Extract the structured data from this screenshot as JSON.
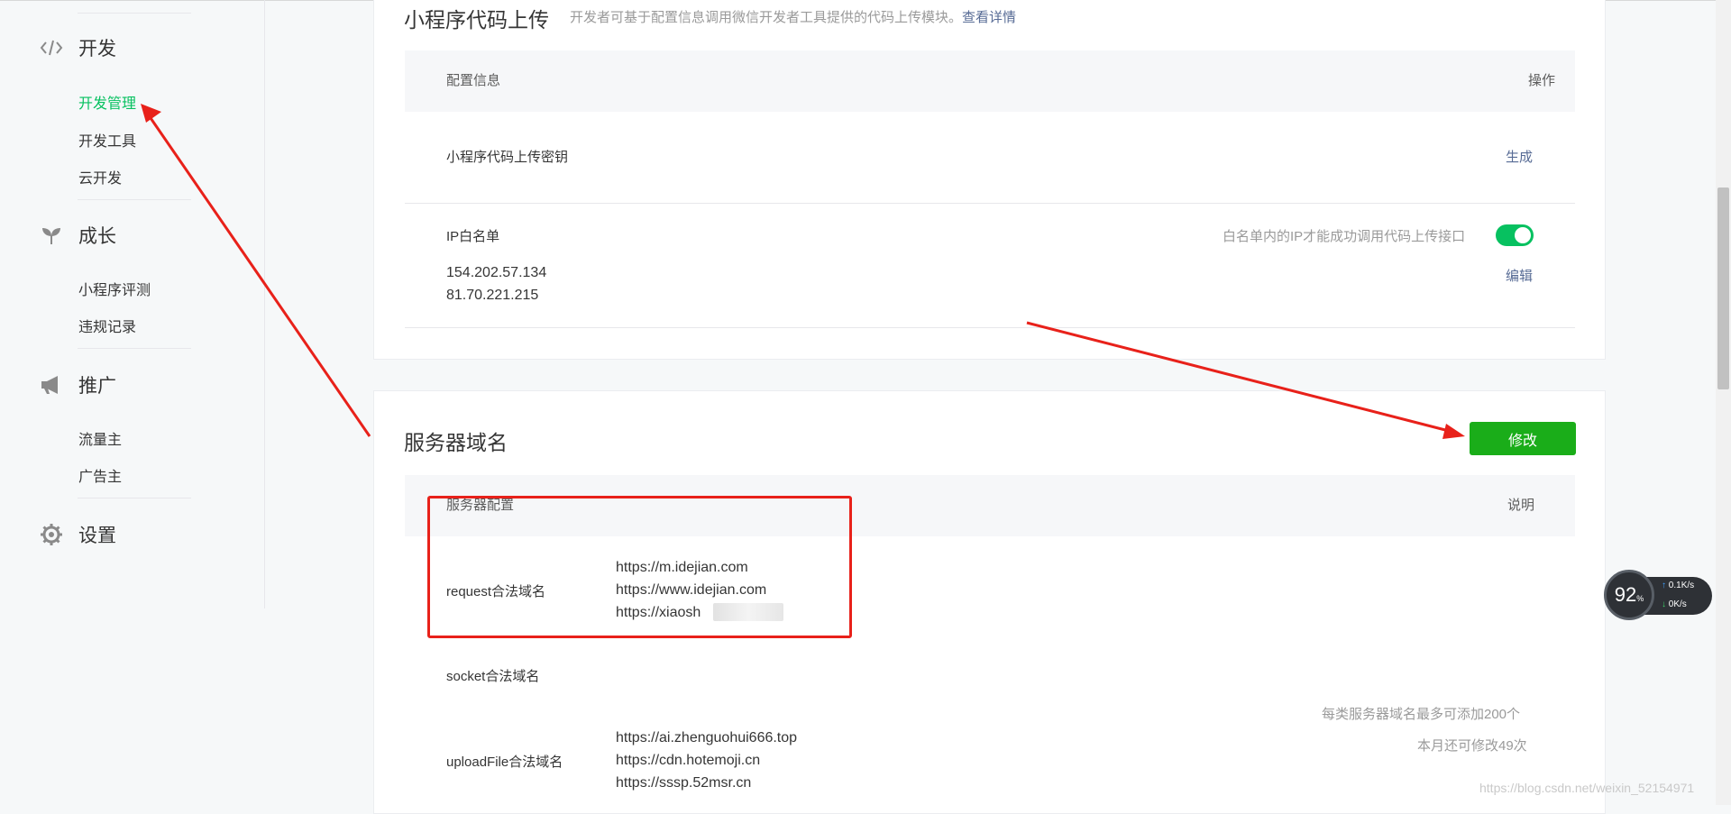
{
  "sidebar": {
    "groups": [
      {
        "label": "开发",
        "icon": "code-icon",
        "items": [
          {
            "label": "开发管理",
            "active": true
          },
          {
            "label": "开发工具"
          },
          {
            "label": "云开发"
          }
        ]
      },
      {
        "label": "成长",
        "icon": "sprout-icon",
        "items": [
          {
            "label": "小程序评测"
          },
          {
            "label": "违规记录"
          }
        ]
      },
      {
        "label": "推广",
        "icon": "megaphone-icon",
        "items": [
          {
            "label": "流量主"
          },
          {
            "label": "广告主"
          }
        ]
      },
      {
        "label": "设置",
        "icon": "gear-icon",
        "items": []
      }
    ]
  },
  "upload": {
    "title": "小程序代码上传",
    "desc": "开发者可基于配置信息调用微信开发者工具提供的代码上传模块。",
    "desc_link": "查看详情",
    "col_config": "配置信息",
    "col_action": "操作",
    "key_label": "小程序代码上传密钥",
    "key_action": "生成",
    "ip_label": "IP白名单",
    "ip_hint": "白名单内的IP才能成功调用代码上传接口",
    "ip_toggle_on": true,
    "ips": [
      "154.202.57.134",
      "81.70.221.215"
    ],
    "ip_action": "编辑"
  },
  "server": {
    "title": "服务器域名",
    "modify_button": "修改",
    "col_config": "服务器配置",
    "col_desc": "说明",
    "request_label": "request合法域名",
    "request_domains": [
      "https://m.idejian.com",
      "https://www.idejian.com",
      "https://xiaosh"
    ],
    "socket_label": "socket合法域名",
    "note_limit": "每类服务器域名最多可添加200个",
    "note_remaining": "本月还可修改49次",
    "upload_label": "uploadFile合法域名",
    "upload_domains": [
      "https://ai.zhenguohui666.top",
      "https://cdn.hotemoji.cn",
      "https://sssp.52msr.cn"
    ]
  },
  "net_widget": {
    "percent": "92",
    "percent_unit": "%",
    "up_rate": "0.1",
    "up_unit": "K/s",
    "down_rate": "0",
    "down_unit": "K/s"
  },
  "watermark": "https://blog.csdn.net/weixin_52154971",
  "colors": {
    "brand_green": "#07c160",
    "button_green": "#1aad19",
    "link_blue": "#576b95",
    "annotation_red": "#e8211a"
  }
}
